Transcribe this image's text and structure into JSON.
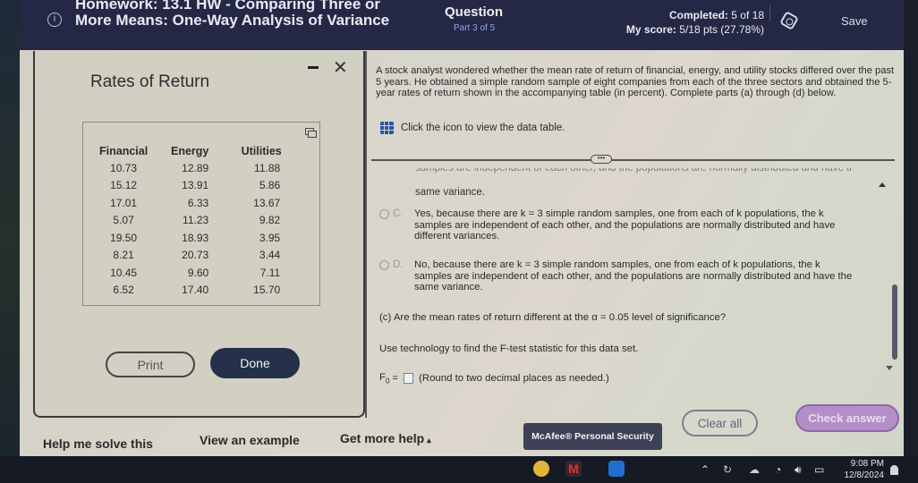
{
  "header": {
    "homework_title": "Homework: 13.1 HW - Comparing Three or More Means: One-Way Analysis of Variance",
    "question_label": "Question",
    "part": "Part 3 of 5",
    "completed_label": "Completed:",
    "completed_value": "5 of 18",
    "score_label": "My score:",
    "score_value": "5/18 pts (27.78%)",
    "save_label": "Save"
  },
  "modal": {
    "title": "Rates of Return",
    "columns": [
      "Financial",
      "Energy",
      "Utilities"
    ],
    "rows": [
      [
        "10.73",
        "12.89",
        "11.88"
      ],
      [
        "15.12",
        "13.91",
        "5.86"
      ],
      [
        "17.01",
        "6.33",
        "13.67"
      ],
      [
        "5.07",
        "11.23",
        "9.82"
      ],
      [
        "19.50",
        "18.93",
        "3.95"
      ],
      [
        "8.21",
        "20.73",
        "3.44"
      ],
      [
        "10.45",
        "9.60",
        "7.11"
      ],
      [
        "6.52",
        "17.40",
        "15.70"
      ]
    ],
    "print_label": "Print",
    "done_label": "Done"
  },
  "question": {
    "text": "A stock analyst wondered whether the mean rate of return of financial, energy, and utility stocks differed over the past 5 years. He obtained a simple random sample of eight companies from each of the three sectors and obtained the 5-year rates of return shown in the accompanying table (in percent). Complete parts (a) through (d) below.",
    "data_link": "Click the icon to view the data table.",
    "expand_handle": "•••",
    "cut_line": "samples are independent of each other, and the populations are normally distributed and have the",
    "prev_option_tail": "same variance.",
    "options": [
      {
        "letter": "C.",
        "text": "Yes, because there are k = 3 simple random samples, one from each of k populations, the k samples are independent of each other, and the populations are normally distributed and have different variances."
      },
      {
        "letter": "D.",
        "text": "No, because there are k = 3 simple random samples, one from each of k populations, the k samples are independent of each other, and the populations are normally distributed and have the same variance."
      }
    ],
    "part_c": "(c) Are the mean rates of return different at the α = 0.05 level of significance?",
    "technology": "Use technology to find the F-test statistic for this data set.",
    "f_label": "F",
    "f_sub": "0",
    "f_eq": "=",
    "f_value": "",
    "round_note": "(Round to two decimal places as needed.)"
  },
  "footer": {
    "help_me_solve": "Help me solve this",
    "view_example": "View an example",
    "get_more_help": "Get more help",
    "get_more_help_caret": "▴",
    "mcafee": "McAfee® Personal Security",
    "clear_all": "Clear all",
    "check_answer": "Check answer"
  },
  "taskbar": {
    "time": "9:08 PM",
    "date": "12/8/2024"
  },
  "colors": {
    "header_bg": "#242844",
    "done_button": "#24304a",
    "check_answer": "#b48ec8",
    "link_blue": "#2b4fb0"
  }
}
